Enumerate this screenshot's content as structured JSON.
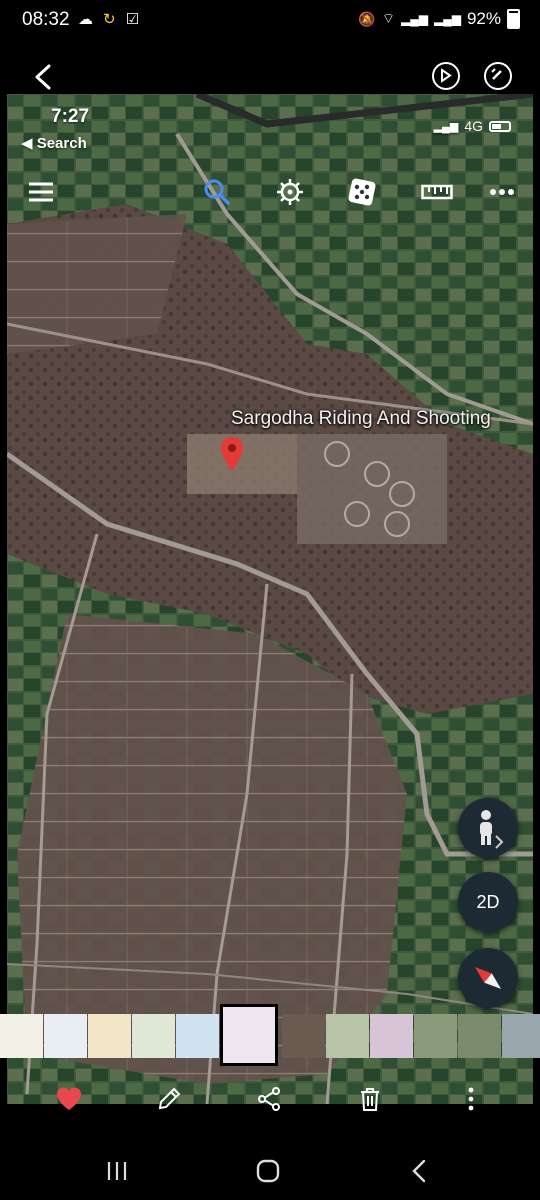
{
  "status_bar": {
    "time": "08:32",
    "battery": "92%",
    "icons": [
      "cloud-icon",
      "sync-icon",
      "checkbox-icon",
      "mute-icon",
      "wifi-icon",
      "signal-icon",
      "signal-icon",
      "battery-icon"
    ]
  },
  "viewer": {
    "back_icon": "back-arrow-icon",
    "top_actions": [
      "remaster-icon",
      "rotate-edit-icon"
    ],
    "bottom_actions": [
      "heart-icon",
      "pencil-icon",
      "share-icon",
      "trash-icon",
      "more-vertical-icon"
    ],
    "favorite_color": "#e8474f"
  },
  "screenshot": {
    "time": "7:27",
    "back_label": "◀ Search",
    "network": "4G",
    "toolbar_icons": [
      "menu-icon",
      "search-icon",
      "voyager-icon",
      "dice-icon",
      "ruler-icon",
      "more-icon"
    ],
    "place_label": "Sargodha Riding And Shooting",
    "pegman_icon": "pegman-icon",
    "view_mode": "2D",
    "compass_icon": "compass-icon"
  },
  "thumbnails": {
    "count": 14,
    "active_index": 5
  },
  "nav_bar": {
    "icons": [
      "recents-icon",
      "home-icon",
      "back-icon"
    ]
  }
}
